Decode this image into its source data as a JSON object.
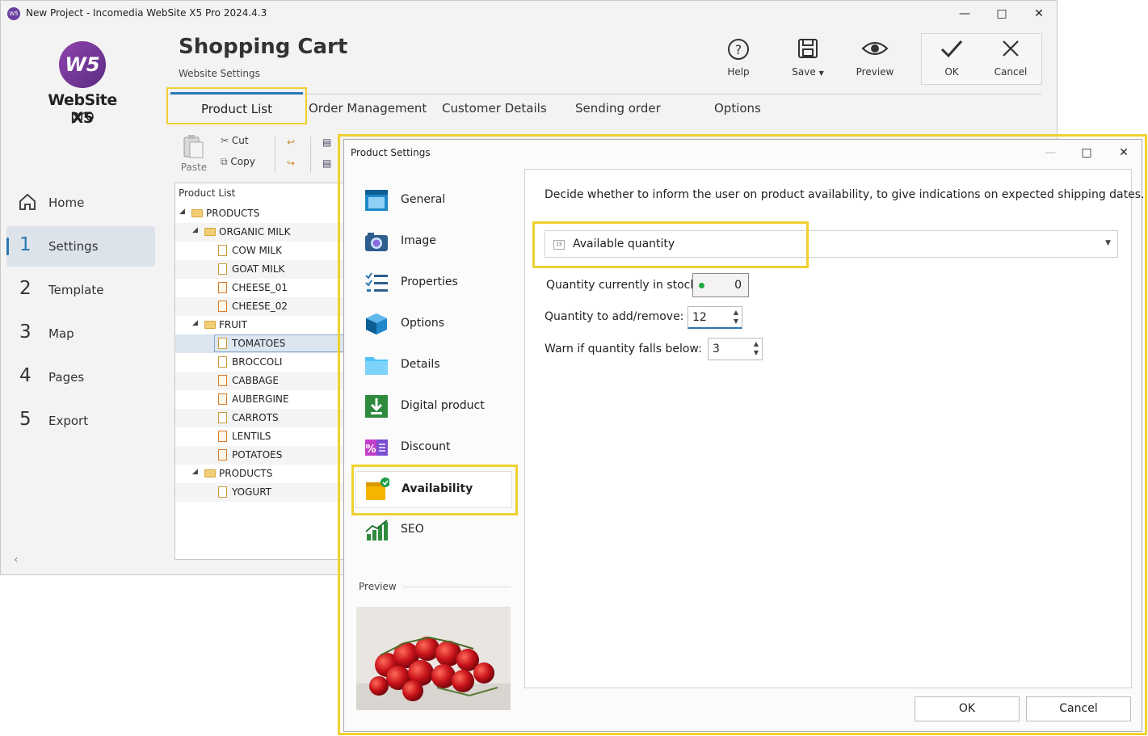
{
  "window": {
    "title": "New Project - Incomedia WebSite X5 Pro 2024.4.3"
  },
  "logo": {
    "mark": "W5",
    "text": "WebSite X5",
    "sub": "pro"
  },
  "header": {
    "title": "Shopping Cart",
    "subtitle": "Website Settings"
  },
  "toolbar": {
    "help": "Help",
    "save": "Save",
    "preview": "Preview",
    "ok": "OK",
    "cancel": "Cancel"
  },
  "tabs": [
    "Product List",
    "Order Management",
    "Customer Details",
    "Sending order",
    "Options"
  ],
  "edit": {
    "paste": "Paste",
    "cut": "Cut",
    "copy": "Copy"
  },
  "nav": [
    {
      "num": "",
      "label": "Home"
    },
    {
      "num": "1",
      "label": "Settings"
    },
    {
      "num": "2",
      "label": "Template"
    },
    {
      "num": "3",
      "label": "Map"
    },
    {
      "num": "4",
      "label": "Pages"
    },
    {
      "num": "5",
      "label": "Export"
    }
  ],
  "tree": {
    "header": "Product List",
    "rows": [
      "PRODUCTS",
      "ORGANIC MILK",
      "COW MILK",
      "GOAT MILK",
      "CHEESE_01",
      "CHEESE_02",
      "FRUIT",
      "TOMATOES",
      "BROCCOLI",
      "CABBAGE",
      "AUBERGINE",
      "CARROTS",
      "LENTILS",
      "POTATOES",
      "PRODUCTS",
      "YOGURT"
    ]
  },
  "dialog": {
    "title": "Product Settings",
    "categories": [
      "General",
      "Image",
      "Properties",
      "Options",
      "Details",
      "Digital product",
      "Discount",
      "Availability",
      "SEO"
    ],
    "preview_label": "Preview",
    "description": "Decide whether to inform the user on product availability, to give indications on expected shipping dates.",
    "availability_mode": "Available quantity",
    "stock_label": "Quantity currently in stock:",
    "stock_value": "0",
    "add_label": "Quantity to add/remove:",
    "add_value": "12",
    "warn_label": "Warn if quantity falls  below:",
    "warn_value": "3",
    "ok": "OK",
    "cancel": "Cancel"
  }
}
